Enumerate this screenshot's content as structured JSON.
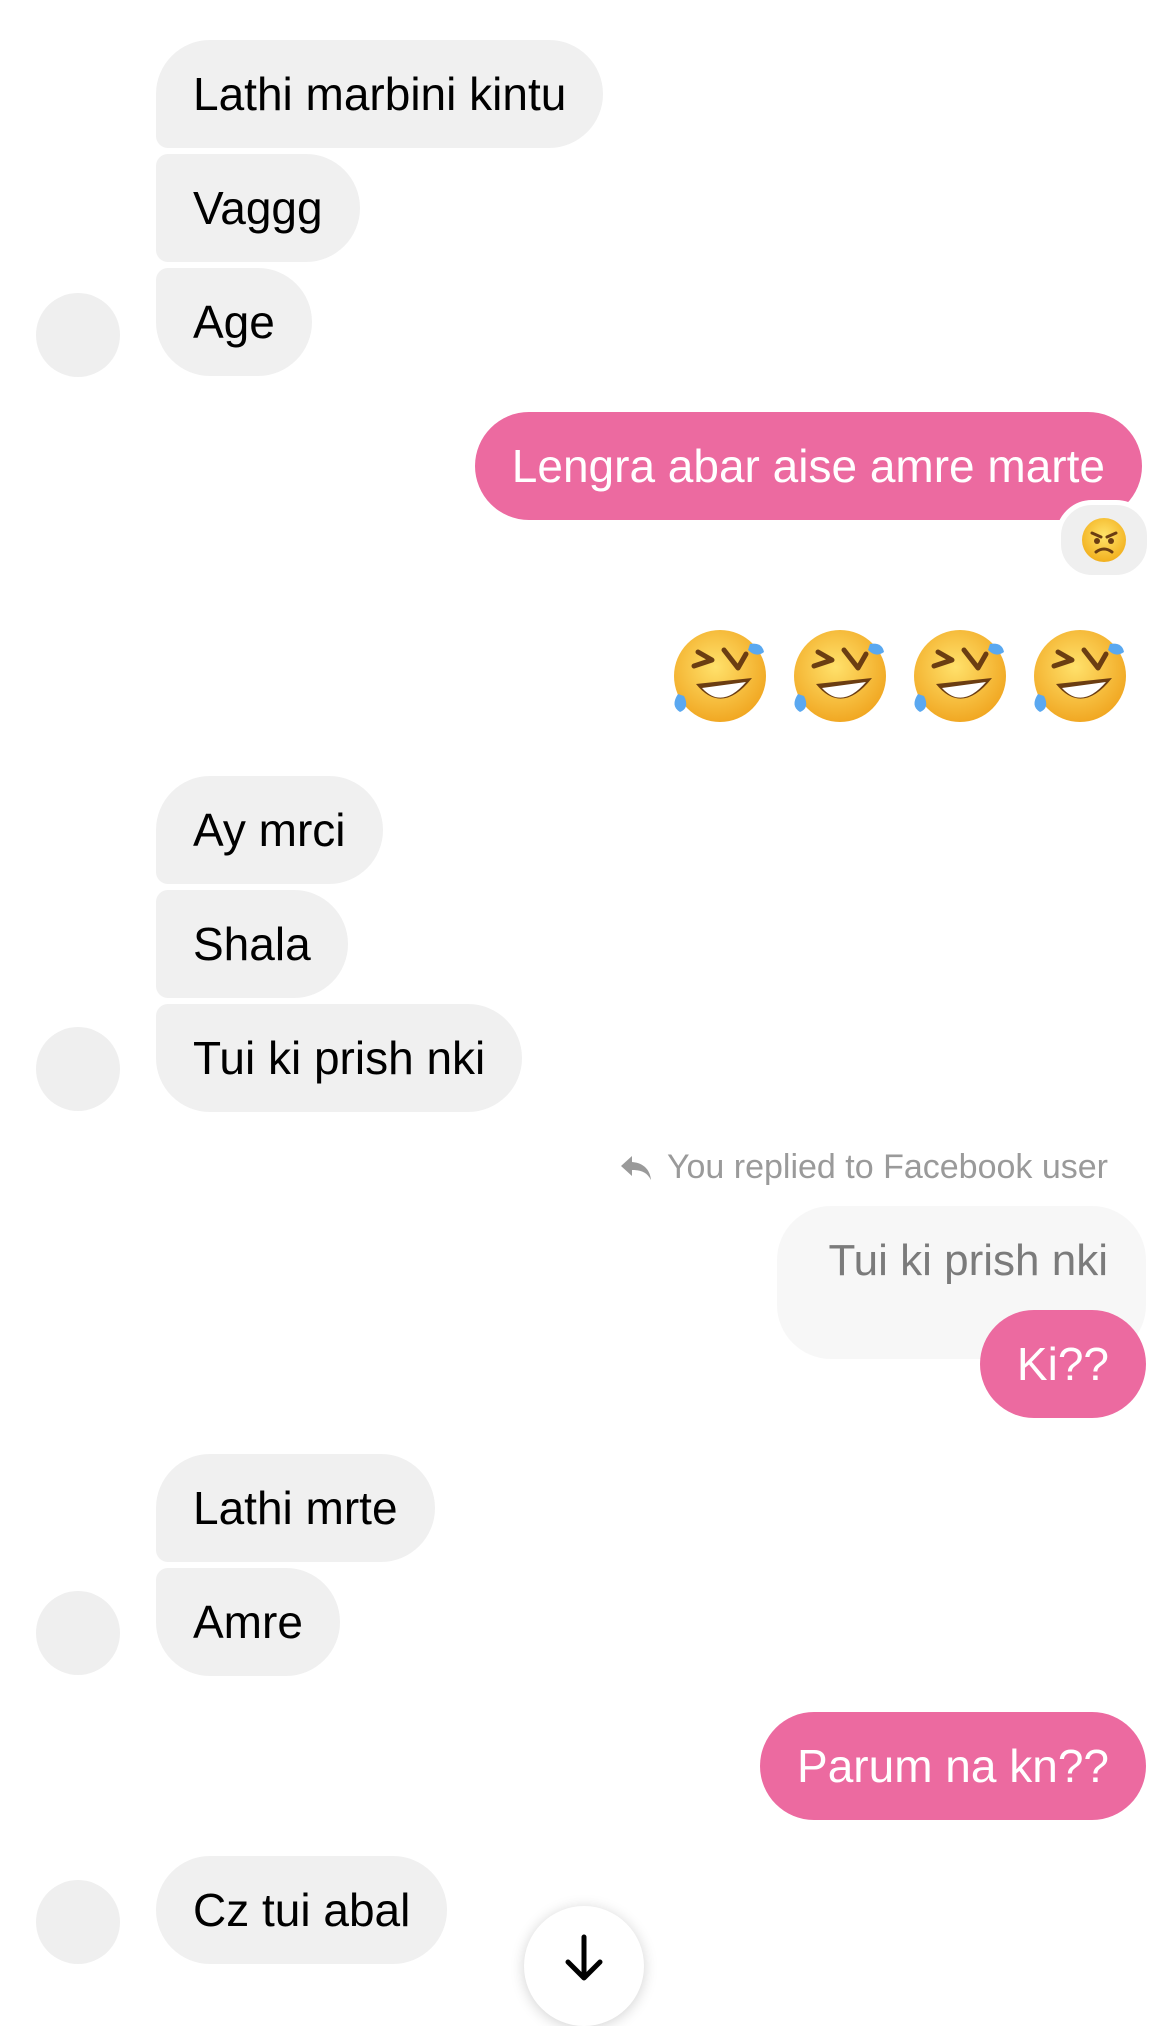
{
  "messages": {
    "m1": "Lathi marbini kintu",
    "m2": "Vaggg",
    "m3": "Age",
    "m4": "Lengra abar aise amre marte",
    "m6": "Ay mrci",
    "m7": "Shala",
    "m8": "Tui ki prish nki",
    "m10": "Ki??",
    "m11": "Lathi mrte",
    "m12": "Amre",
    "m13": "Parum na kn??",
    "m14": "Cz tui abal"
  },
  "reply": {
    "label": "You replied to Facebook user",
    "quoted_text": "Tui ki prish nki"
  },
  "icons": {
    "reaction": "angry-face-emoji",
    "big_emoji": "rolling-on-the-floor-laughing-emoji",
    "reply": "reply-arrow-icon",
    "scroll": "arrow-down-icon"
  },
  "colors": {
    "outgoing_bubble": "#ec6aa0",
    "incoming_bubble": "#f0f0f0"
  }
}
